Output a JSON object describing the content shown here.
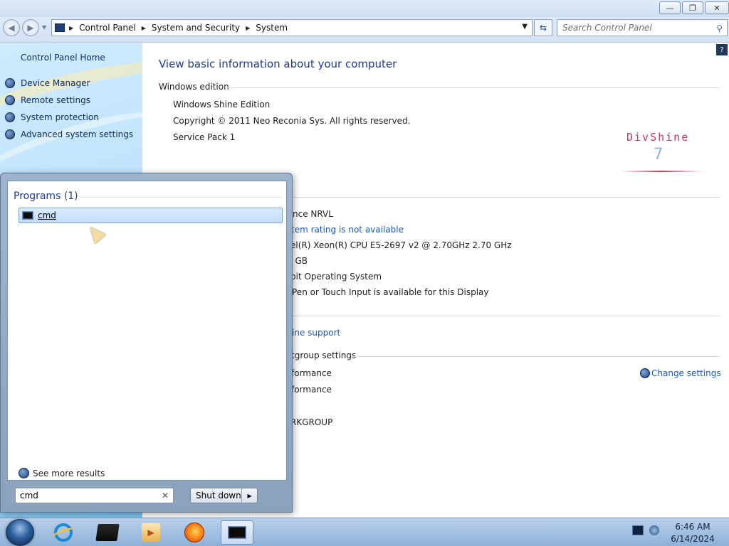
{
  "window": {
    "caption_buttons": {
      "minimize": "—",
      "restore": "❐",
      "close": "✕"
    }
  },
  "address_bar": {
    "breadcrumbs": [
      "Control Panel",
      "System and Security",
      "System"
    ],
    "search_placeholder": "Search Control Panel"
  },
  "left_nav": {
    "home": "Control Panel Home",
    "items": [
      "Device Manager",
      "Remote settings",
      "System protection",
      "Advanced system settings"
    ]
  },
  "main": {
    "title": "View basic information about your computer",
    "windows_edition": {
      "heading": "Windows edition",
      "edition": "Windows Shine Edition",
      "copyright": "Copyright © 2011 Neo Reconia Sys.  All rights reserved.",
      "service_pack": "Service Pack 1",
      "brand_text": "DivShine",
      "brand_num": "7"
    },
    "system": {
      "manufacturer": "nce NRVL",
      "rating_link": "tem rating is not available",
      "processor": "el(R) Xeon(R) CPU E5-2697 v2 @ 2.70GHz   2.70 GHz",
      "memory": ") GB",
      "system_type": "bit Operating System",
      "pen_touch": "Pen or Touch Input is available for this Display"
    },
    "support_link": "ine support",
    "computer_name": {
      "heading": "tgroup settings",
      "computer_name": "formance",
      "full_name": "formance",
      "workgroup": "RKGROUP",
      "change_settings": "Change settings"
    }
  },
  "start_menu": {
    "programs_header": "Programs (1)",
    "results": [
      "cmd"
    ],
    "see_more": "See more results",
    "search_value": "cmd",
    "shutdown_label": "Shut down"
  },
  "taskbar": {
    "time": "6:46 AM",
    "date": "6/14/2024"
  }
}
